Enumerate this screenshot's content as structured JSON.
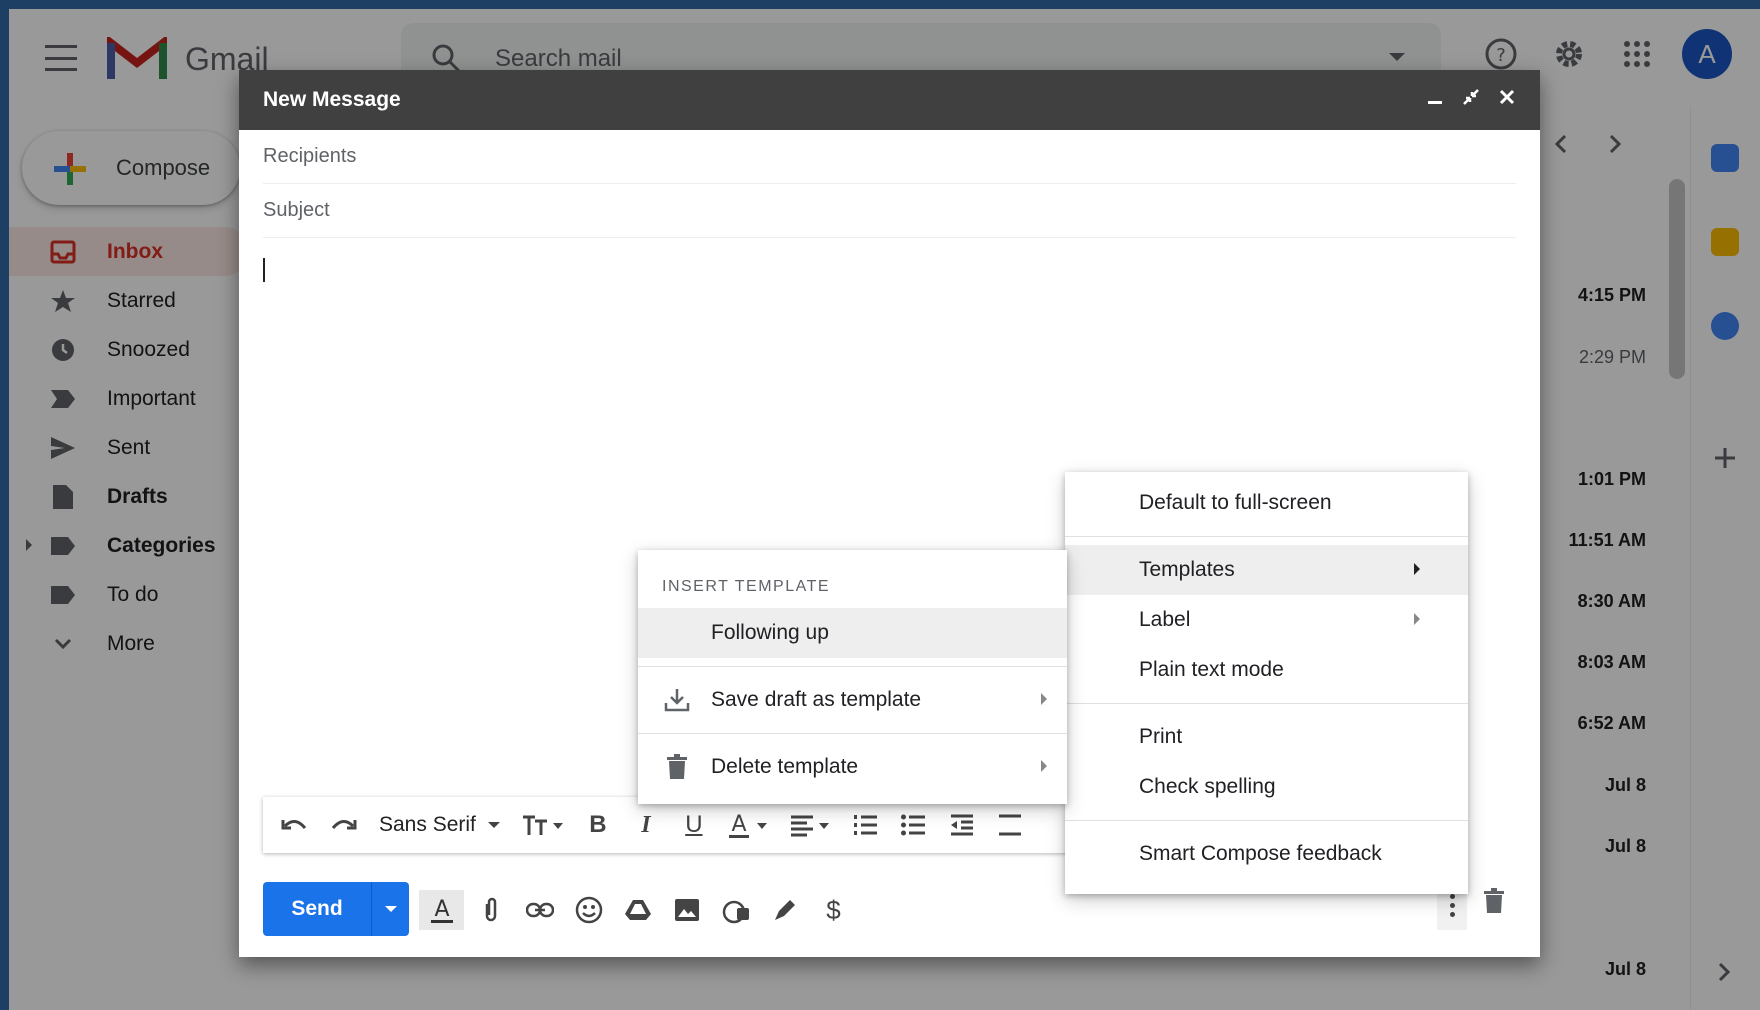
{
  "app": {
    "logo_text": "Gmail",
    "search_placeholder": "Search mail",
    "avatar_initial": "A",
    "compose_label": "Compose",
    "nav": [
      {
        "label": "Inbox",
        "icon": "inbox-icon",
        "active": true
      },
      {
        "label": "Starred",
        "icon": "star-icon"
      },
      {
        "label": "Snoozed",
        "icon": "clock-icon"
      },
      {
        "label": "Important",
        "icon": "important-icon"
      },
      {
        "label": "Sent",
        "icon": "send-icon"
      },
      {
        "label": "Drafts",
        "icon": "draft-icon",
        "bold": true
      },
      {
        "label": "Categories",
        "icon": "label-icon",
        "bold": true
      },
      {
        "label": "To do",
        "icon": "label-icon"
      },
      {
        "label": "More",
        "icon": "chevron-down-icon"
      }
    ],
    "times": [
      "4:15 PM",
      "2:29 PM",
      "1:01 PM",
      "11:51 AM",
      "8:30 AM",
      "8:03 AM",
      "6:52 AM",
      "Jul 8",
      "Jul 8",
      "Jul 8"
    ]
  },
  "compose": {
    "title": "New Message",
    "recipients_placeholder": "Recipients",
    "subject_placeholder": "Subject",
    "font_name": "Sans Serif",
    "send_label": "Send"
  },
  "more_menu": {
    "items": [
      "Default to full-screen",
      "Templates",
      "Label",
      "Plain text mode",
      "Print",
      "Check spelling",
      "Smart Compose feedback"
    ]
  },
  "templates_menu": {
    "header": "INSERT TEMPLATE",
    "template_item": "Following up",
    "save_label": "Save draft as template",
    "delete_label": "Delete template"
  },
  "colors": {
    "accent": "#1a73e8",
    "header_bg": "#404040",
    "gmail_red": "#d93025"
  }
}
